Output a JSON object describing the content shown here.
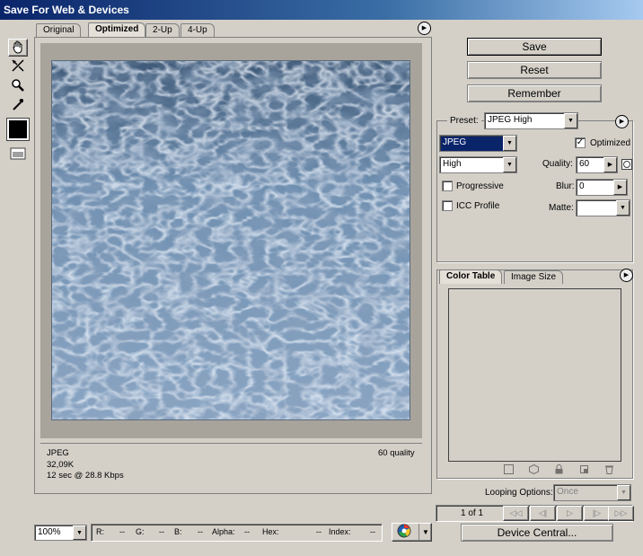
{
  "window": {
    "title": "Save For Web & Devices"
  },
  "tabs": [
    {
      "label": "Original"
    },
    {
      "label": "Optimized"
    },
    {
      "label": "2-Up"
    },
    {
      "label": "4-Up"
    }
  ],
  "image_info": {
    "format": "JPEG",
    "size": "32,09K",
    "time": "12 sec @ 28.8 Kbps",
    "quality_text": "60 quality"
  },
  "buttons": {
    "save": "Save",
    "reset": "Reset",
    "remember": "Remember",
    "device_central": "Device Central..."
  },
  "settings": {
    "preset_label": "Preset:",
    "preset_value": "JPEG High",
    "format_value": "JPEG",
    "quality_preset": "High",
    "optimized_label": "Optimized",
    "quality_label": "Quality:",
    "quality_value": "60",
    "progressive_label": "Progressive",
    "blur_label": "Blur:",
    "blur_value": "0",
    "icc_label": "ICC Profile",
    "matte_label": "Matte:"
  },
  "panel_tabs": [
    {
      "label": "Color Table"
    },
    {
      "label": "Image Size"
    }
  ],
  "looping": {
    "label": "Looping Options:",
    "value": "Once"
  },
  "animation": {
    "frame": "1 of 1"
  },
  "status": {
    "zoom": "100%",
    "r_label": "R:",
    "r_value": "--",
    "g_label": "G:",
    "g_value": "--",
    "b_label": "B:",
    "b_value": "--",
    "alpha_label": "Alpha:",
    "alpha_value": "--",
    "hex_label": "Hex:",
    "hex_value": "--",
    "index_label": "Index:",
    "index_value": "--"
  },
  "icons": [
    "hand-icon",
    "slice-select-icon",
    "zoom-icon",
    "eyedropper-icon",
    "eyedropper-color-swatch",
    "toggle-slices-icon",
    "browser-preview-icon",
    "menu-arrow-icon"
  ],
  "colors": {
    "title_bar": "#0a246a",
    "selected_format_bg": "#0a246a",
    "image_tone": "#6f8fb0"
  }
}
